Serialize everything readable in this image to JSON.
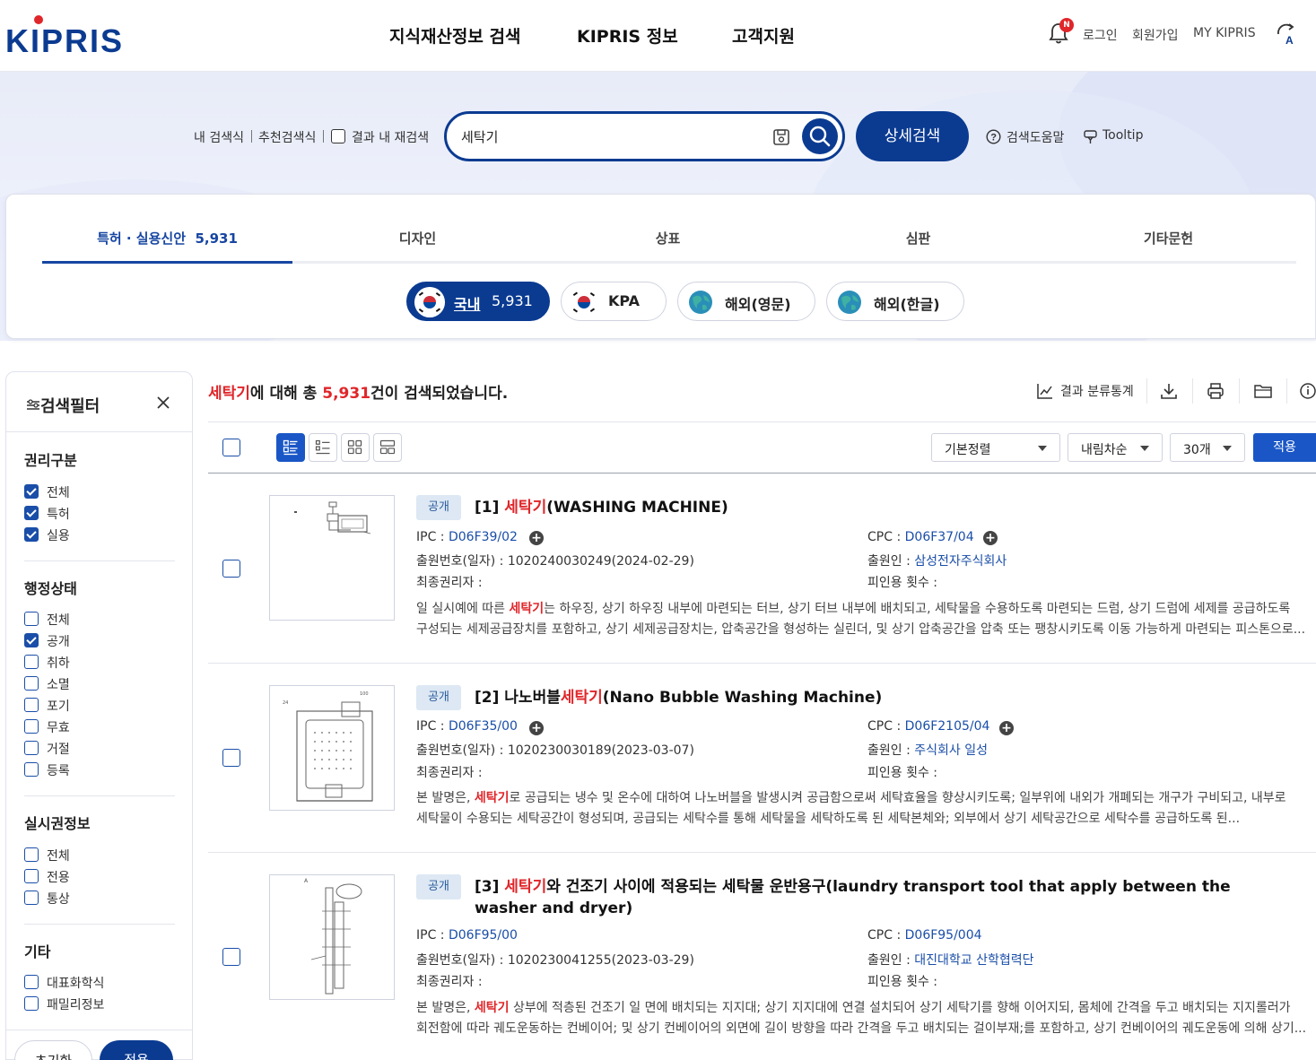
{
  "header": {
    "logo_text": "KIPRIS",
    "nav": [
      "지식재산정보 검색",
      "KIPRIS 정보",
      "고객지원"
    ],
    "notification_badge": "N",
    "util": {
      "login": "로그인",
      "signup": "회원가입",
      "my": "MY KIPRIS"
    }
  },
  "search": {
    "my_query": "내 검색식",
    "recommended_query": "추천검색식",
    "research_label": "결과 내 재검색",
    "query": "세탁기",
    "advanced_label": "상세검색",
    "help_label": "검색도움말",
    "tooltip_label": "Tooltip"
  },
  "categories": {
    "tabs": [
      {
        "label": "특허 · 실용신안",
        "count": "5,931",
        "active": true
      },
      {
        "label": "디자인"
      },
      {
        "label": "상표"
      },
      {
        "label": "심판"
      },
      {
        "label": "기타문헌"
      }
    ],
    "pills": [
      {
        "label": "국내",
        "count": "5,931",
        "active": true,
        "icon": "korea-flag-icon"
      },
      {
        "label": "KPA",
        "icon": "korea-flag-icon"
      },
      {
        "label": "해외(영문)",
        "icon": "globe-icon"
      },
      {
        "label": "해외(한글)",
        "icon": "globe-icon"
      }
    ]
  },
  "filter": {
    "title": "검색필터",
    "groups": [
      {
        "title": "권리구분",
        "items": [
          {
            "label": "전체",
            "checked": true
          },
          {
            "label": "특허",
            "checked": true
          },
          {
            "label": "실용",
            "checked": true
          }
        ]
      },
      {
        "title": "행정상태",
        "items": [
          {
            "label": "전체",
            "checked": false
          },
          {
            "label": "공개",
            "checked": true
          },
          {
            "label": "취하",
            "checked": false
          },
          {
            "label": "소멸",
            "checked": false
          },
          {
            "label": "포기",
            "checked": false
          },
          {
            "label": "무효",
            "checked": false
          },
          {
            "label": "거절",
            "checked": false
          },
          {
            "label": "등록",
            "checked": false
          }
        ]
      },
      {
        "title": "실시권정보",
        "items": [
          {
            "label": "전체",
            "checked": false
          },
          {
            "label": "전용",
            "checked": false
          },
          {
            "label": "통상",
            "checked": false
          }
        ]
      },
      {
        "title": "기타",
        "items": [
          {
            "label": "대표화학식",
            "checked": false
          },
          {
            "label": "패밀리정보",
            "checked": false
          }
        ]
      }
    ],
    "reset_label": "초기화",
    "apply_label": "적용"
  },
  "results": {
    "summary": {
      "keyword": "세탁기",
      "mid": "에 대해 총 ",
      "count": "5,931",
      "tail": "건이 검색되었습니다."
    },
    "stats_label": "결과 분류통계",
    "sort_label": "기본정렬",
    "order_label": "내림차순",
    "per_page_label": "30개",
    "apply_label": "적용",
    "labels": {
      "ipc": "IPC : ",
      "cpc": "CPC : ",
      "appno": "출원번호(일자) : ",
      "applicant": "출원인 : ",
      "holder": "최종권리자 : ",
      "cited": "피인용 횟수 : "
    },
    "items": [
      {
        "status": "공개",
        "num": "[1] ",
        "title_pre": "",
        "title_hl": "세탁기",
        "title_post": "(WASHING MACHINE)",
        "ipc": "D06F39/02",
        "cpc": "D06F37/04",
        "app_no": "1020240030249(2024-02-29)",
        "applicant": "삼성전자주식회사",
        "abs1_pre": "일 실시예에 따른 ",
        "abs1_hl": "세탁기",
        "abs1_post": "는 하우징, 상기 하우징 내부에 마련되는 터브, 상기 터브 내부에 배치되고, 세탁물을 수용하도록 마련되는 드럼, 상기 드럼에 세제를 공급하도록",
        "abs2": "구성되는 세제공급장치를 포함하고, 상기 세제공급장치는, 압축공간을 형성하는 실린더, 및 상기 압축공간을 압축 또는 팽창시키도록 이동 가능하게 마련되는 피스톤으로..."
      },
      {
        "status": "공개",
        "num": "[2] ",
        "title_pre": "나노버블",
        "title_hl": "세탁기",
        "title_post": "(Nano Bubble Washing Machine)",
        "ipc": "D06F35/00",
        "cpc": "D06F2105/04",
        "app_no": "1020230030189(2023-03-07)",
        "applicant": "주식회사 일성",
        "abs1_pre": "본 발명은, ",
        "abs1_hl": "세탁기",
        "abs1_post": "로 공급되는 냉수 및 온수에 대하여 나노버블을 발생시켜 공급함으로써 세탁효율을 향상시키도록; 일부위에 내외가 개폐되는 개구가 구비되고, 내부로",
        "abs2": "세탁물이 수용되는 세탁공간이 형성되며, 공급되는 세탁수를 통해 세탁물을 세탁하도록 된 세탁본체와; 외부에서 상기 세탁공간으로 세탁수를 공급하도록 된..."
      },
      {
        "status": "공개",
        "num": "[3] ",
        "title_pre": "",
        "title_hl": "세탁기",
        "title_post": "와 건조기 사이에 적용되는 세탁물 운반용구(laundry transport tool that apply between the washer and dryer)",
        "ipc": "D06F95/00",
        "cpc": "D06F95/004",
        "app_no": "1020230041255(2023-03-29)",
        "applicant": "대진대학교 산학협력단",
        "abs1_pre": "본 발명은, ",
        "abs1_hl": "세탁기",
        "abs1_post": " 상부에 적층된 건조기 일 면에 배치되는 지지대; 상기 지지대에 연결 설치되어 상기 세탁기를 향해 이어지되, 몸체에 간격을 두고 배치되는 지지롤러가",
        "abs2": "회전함에 따라 궤도운동하는 컨베이어; 및 상기 컨베이어의 외면에 길이 방향을 따라 간격을 두고 배치되는 걸이부재;를 포함하고, 상기 컨베이어의 궤도운동에 의해 상기..."
      }
    ]
  },
  "colors": {
    "primary": "#0b3b91",
    "accent_blue": "#1a56c6",
    "highlight": "#e0262a",
    "badge_bg": "#dde8f4"
  }
}
